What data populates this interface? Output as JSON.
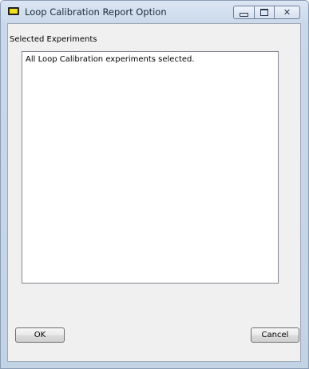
{
  "window": {
    "title": "Loop Calibration Report Option"
  },
  "title_buttons": {
    "minimize_icon": "minimize-icon",
    "maximize_icon": "maximize-icon",
    "close_glyph": "✕"
  },
  "group": {
    "label": "Selected Experiments"
  },
  "list": {
    "items": [
      "All Loop Calibration experiments selected."
    ]
  },
  "buttons": {
    "ok_label": "OK",
    "cancel_label": "Cancel"
  }
}
